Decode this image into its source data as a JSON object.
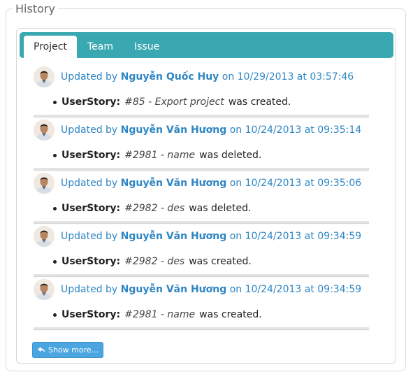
{
  "section": {
    "legend": "History"
  },
  "tabs": [
    {
      "label": "Project",
      "active": true
    },
    {
      "label": "Team",
      "active": false
    },
    {
      "label": "Issue",
      "active": false
    }
  ],
  "entries": [
    {
      "prefix": "Updated by",
      "user": "Nguyễn Quốc Huy",
      "when": "on 10/29/2013 at 03:57:46",
      "label": "UserStory:",
      "story": "#85 - Export project",
      "action": "was created."
    },
    {
      "prefix": "Updated by",
      "user": "Nguyễn Văn Hương",
      "when": "on 10/24/2013 at 09:35:14",
      "label": "UserStory:",
      "story": "#2981 - name",
      "action": "was deleted."
    },
    {
      "prefix": "Updated by",
      "user": "Nguyễn Văn Hương",
      "when": "on 10/24/2013 at 09:35:06",
      "label": "UserStory:",
      "story": "#2982 - des",
      "action": "was deleted."
    },
    {
      "prefix": "Updated by",
      "user": "Nguyễn Văn Hương",
      "when": "on 10/24/2013 at 09:34:59",
      "label": "UserStory:",
      "story": "#2982 - des",
      "action": "was created."
    },
    {
      "prefix": "Updated by",
      "user": "Nguyễn Văn Hương",
      "when": "on 10/24/2013 at 09:34:59",
      "label": "UserStory:",
      "story": "#2981 - name",
      "action": "was created."
    }
  ],
  "show_more": {
    "label": "Show more...",
    "icon": "reply-icon"
  },
  "colors": {
    "tabbar": "#3aa8b0",
    "link": "#2f86c4",
    "button": "#4aa5e0"
  }
}
